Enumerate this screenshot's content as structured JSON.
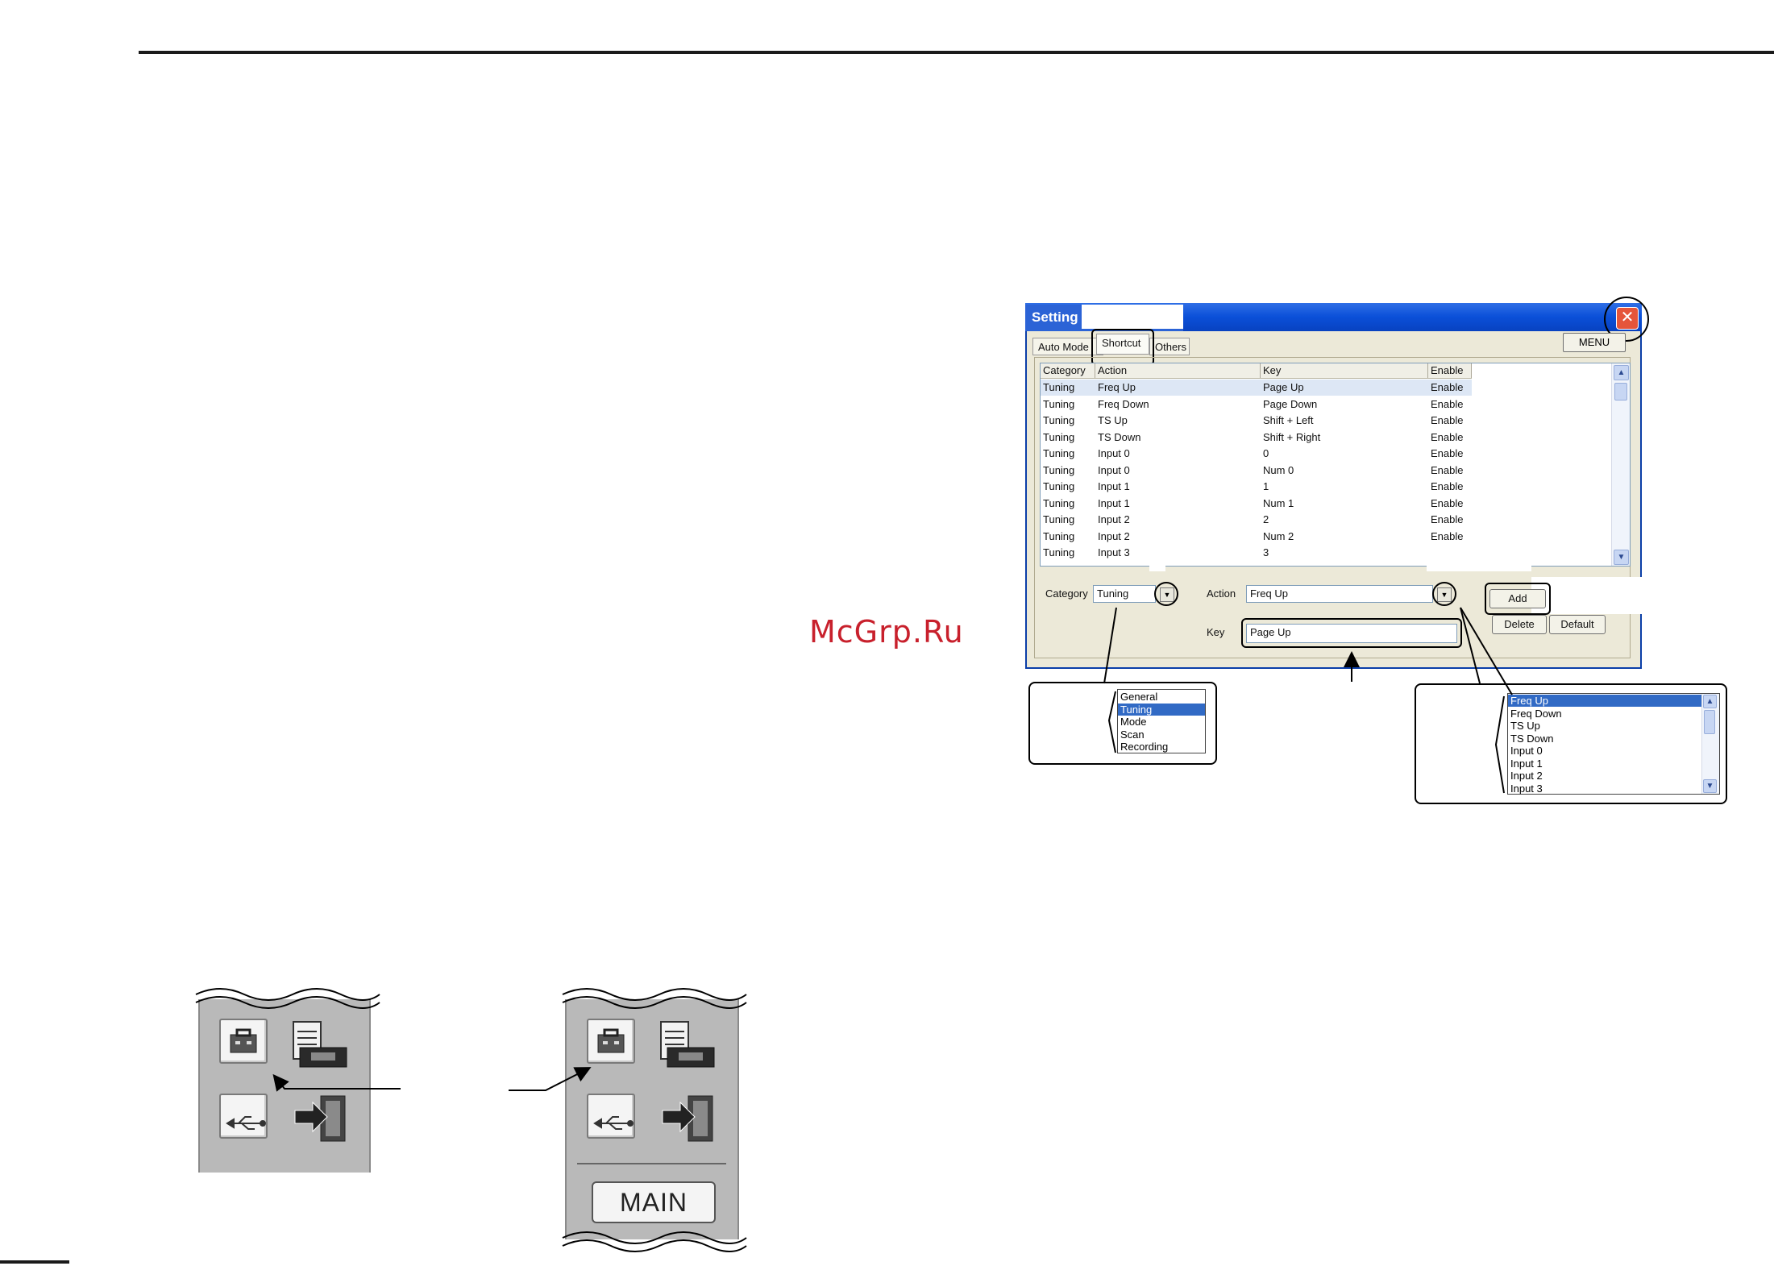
{
  "watermark": "McGrp.Ru",
  "dialog": {
    "title": "Setting",
    "close_glyph": "✕",
    "tabs": {
      "auto": "Auto Mode",
      "shortcut": "Shortcut",
      "others": "Others"
    },
    "menu_label": "MENU",
    "columns": [
      "Category",
      "Action",
      "Key",
      "Enable"
    ],
    "rows": [
      [
        "Tuning",
        "Freq Up",
        "Page Up",
        "Enable"
      ],
      [
        "Tuning",
        "Freq Down",
        "Page Down",
        "Enable"
      ],
      [
        "Tuning",
        "TS Up",
        "Shift + Left",
        "Enable"
      ],
      [
        "Tuning",
        "TS Down",
        "Shift + Right",
        "Enable"
      ],
      [
        "Tuning",
        "Input 0",
        "0",
        "Enable"
      ],
      [
        "Tuning",
        "Input 0",
        "Num 0",
        "Enable"
      ],
      [
        "Tuning",
        "Input 1",
        "1",
        "Enable"
      ],
      [
        "Tuning",
        "Input 1",
        "Num 1",
        "Enable"
      ],
      [
        "Tuning",
        "Input 2",
        "2",
        "Enable"
      ],
      [
        "Tuning",
        "Input 2",
        "Num 2",
        "Enable"
      ],
      [
        "Tuning",
        "Input 3",
        "3",
        ""
      ]
    ],
    "category_label": "Category",
    "category_value": "Tuning",
    "action_label": "Action",
    "action_value": "Freq Up",
    "key_label": "Key",
    "key_value": "Page Up",
    "add_label": "Add",
    "delete_label": "Delete",
    "default_label": "Default"
  },
  "category_options": [
    "General",
    "Tuning",
    "Mode",
    "Scan",
    "Recording"
  ],
  "category_selected": "Tuning",
  "action_options": [
    "Freq Up",
    "Freq Down",
    "TS Up",
    "TS Down",
    "Input 0",
    "Input 1",
    "Input 2",
    "Input 3"
  ],
  "action_selected": "Freq Up",
  "toolbar": {
    "main_label": "MAIN"
  },
  "icons": [
    "toolbox-icon",
    "document-radio-icon",
    "usb-icon",
    "exit-door-icon"
  ],
  "colors": {
    "title_blue": "#0a4fd8",
    "close_red": "#e5553a",
    "selection_blue": "#316ac5",
    "watermark_red": "#c8202c"
  }
}
